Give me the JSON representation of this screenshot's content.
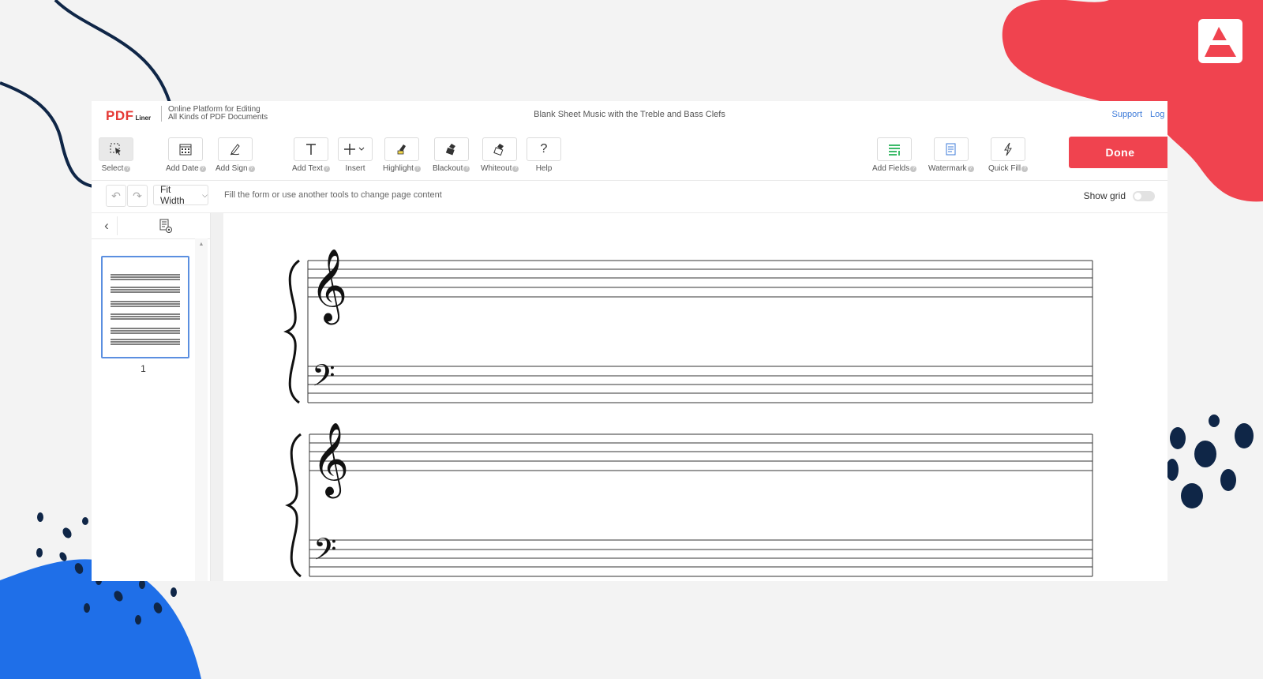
{
  "header": {
    "logo_pdf": "PDF",
    "logo_liner": "Liner",
    "tagline_line1": "Online Platform for Editing",
    "tagline_line2": "All Kinds of PDF Documents",
    "document_title": "Blank Sheet Music with the Treble and Bass Clefs",
    "support_link": "Support",
    "login_link": "Log in"
  },
  "toolbar": {
    "select": "Select",
    "add_date": "Add Date",
    "add_sign": "Add Sign",
    "add_text": "Add Text",
    "insert": "Insert",
    "highlight": "Highlight",
    "blackout": "Blackout",
    "whiteout": "Whiteout",
    "help": "Help",
    "add_fields": "Add Fields",
    "watermark": "Watermark",
    "quick_fill": "Quick Fill",
    "done": "Done",
    "help_glyph": "?"
  },
  "subbar": {
    "zoom": "Fit Width",
    "hint": "Fill the form or use another tools to change page content",
    "show_grid": "Show grid",
    "show_grid_on": false
  },
  "sidebar": {
    "page_number": "1"
  },
  "colors": {
    "accent_red": "#f0434f",
    "link_blue": "#3d7bd9",
    "thumb_border": "#5b8fe0",
    "deco_blue": "#1f6fe8",
    "deco_navy": "#0f2647"
  }
}
